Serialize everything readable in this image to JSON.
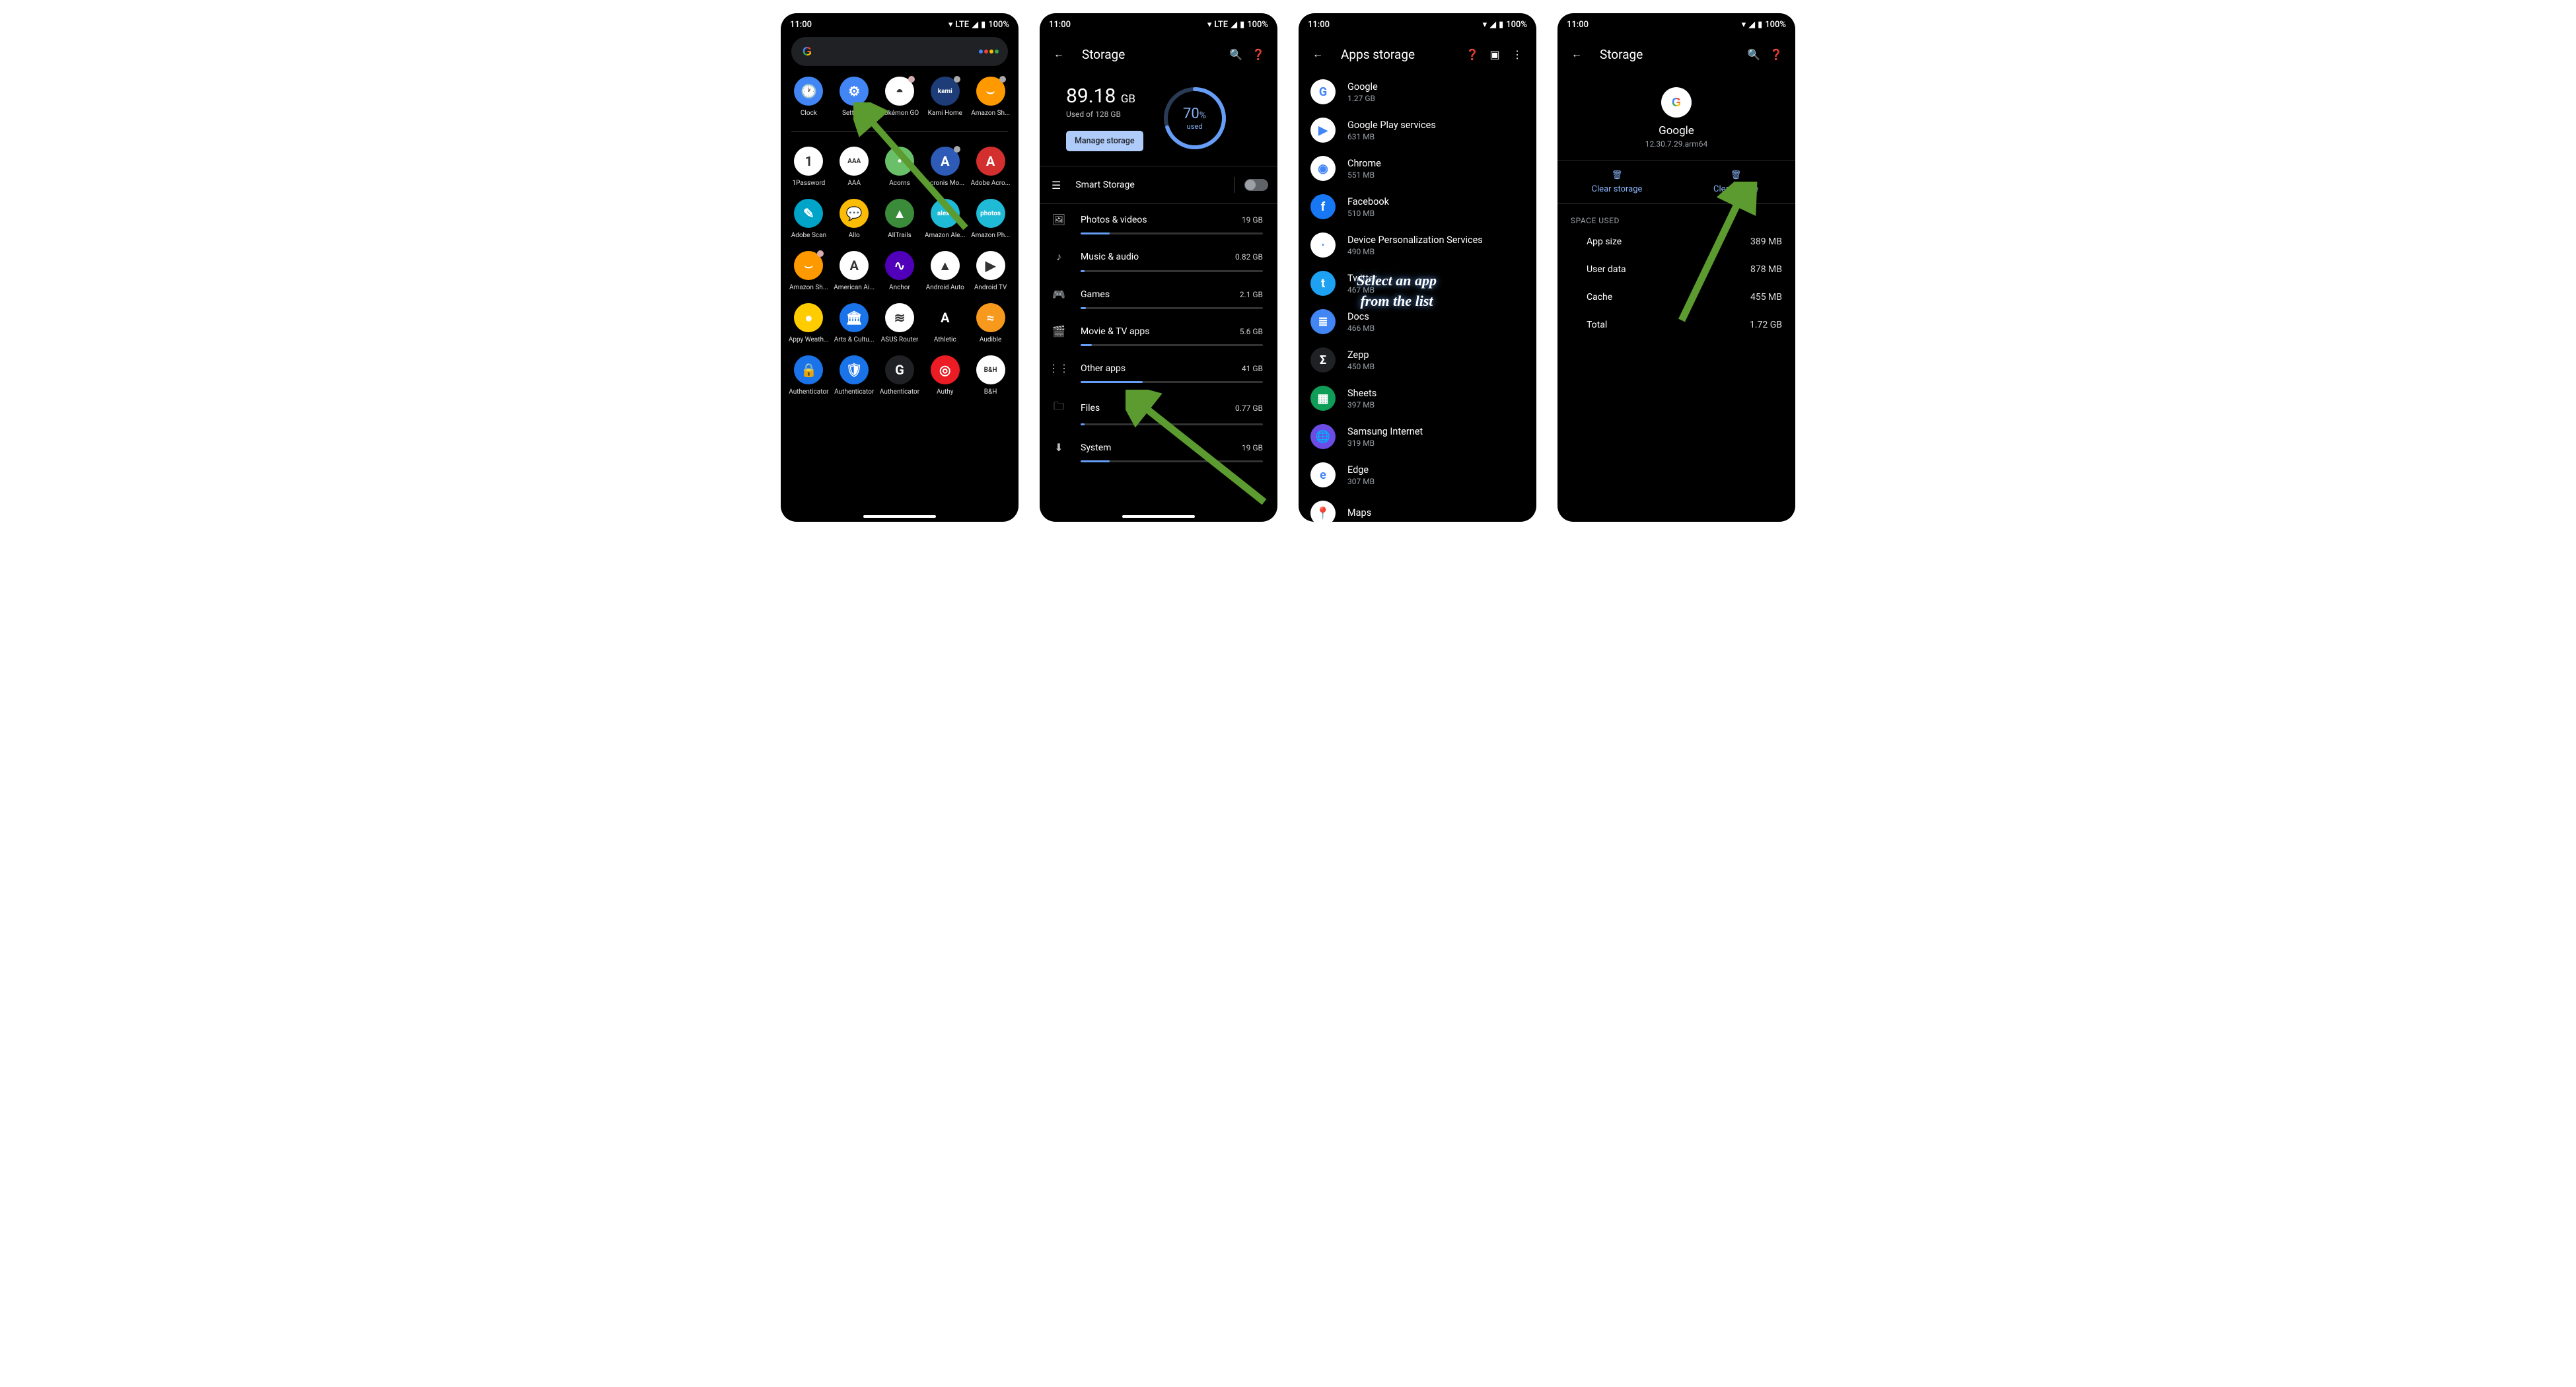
{
  "status": {
    "time": "11:00",
    "net": "LTE",
    "battery": "100%"
  },
  "screen1": {
    "apps_row1": [
      {
        "name": "Clock",
        "bg": "#4285f4",
        "char": "🕐"
      },
      {
        "name": "Settings",
        "bg": "#4285f4",
        "char": "⚙"
      },
      {
        "name": "Pokémon GO",
        "bg": "#fff",
        "char": "◓",
        "dot": "#d6aeb1"
      },
      {
        "name": "Kami Home",
        "bg": "#1d3c78",
        "char": "kami",
        "dot": "#aaa"
      },
      {
        "name": "Amazon Sh...",
        "bg": "#ff9900",
        "char": "⌣",
        "dot": "#aaa"
      }
    ],
    "apps_rest": [
      {
        "name": "1Password",
        "bg": "#fff",
        "char": "1"
      },
      {
        "name": "AAA",
        "bg": "#fff",
        "char": "AAA"
      },
      {
        "name": "Acorns",
        "bg": "#6ac069",
        "char": "•"
      },
      {
        "name": "Acronis Mo...",
        "bg": "#2d5bb7",
        "char": "A",
        "dot": "#aaa"
      },
      {
        "name": "Adobe Acro...",
        "bg": "#d32f2f",
        "char": "A"
      },
      {
        "name": "Adobe Scan",
        "bg": "#00a4c8",
        "char": "✎"
      },
      {
        "name": "Allo",
        "bg": "#fbbc05",
        "char": "💬"
      },
      {
        "name": "AllTrails",
        "bg": "#3a8b3a",
        "char": "▲"
      },
      {
        "name": "Amazon Ale...",
        "bg": "#1fbad6",
        "char": "alexa"
      },
      {
        "name": "Amazon Ph...",
        "bg": "#1fbad6",
        "char": "photos"
      },
      {
        "name": "Amazon Sh...",
        "bg": "#ff9900",
        "char": "⌣",
        "dot": "#d6aeb1"
      },
      {
        "name": "American Ai...",
        "bg": "#fff",
        "char": "A"
      },
      {
        "name": "Anchor",
        "bg": "#5000b9",
        "char": "∿"
      },
      {
        "name": "Android Auto",
        "bg": "#fff",
        "char": "▲"
      },
      {
        "name": "Android TV",
        "bg": "#fff",
        "char": "▶"
      },
      {
        "name": "Appy Weath...",
        "bg": "#ffcc00",
        "char": "●"
      },
      {
        "name": "Arts & Cultu...",
        "bg": "#1a73e8",
        "char": "🏛"
      },
      {
        "name": "ASUS Router",
        "bg": "#fff",
        "char": "≋"
      },
      {
        "name": "Athletic",
        "bg": "#000",
        "char": "A"
      },
      {
        "name": "Audible",
        "bg": "#f7991c",
        "char": "≈"
      },
      {
        "name": "Authenticator",
        "bg": "#1a73e8",
        "char": "🔒"
      },
      {
        "name": "Authenticator",
        "bg": "#1a73e8",
        "char": "🛡"
      },
      {
        "name": "Authenticator",
        "bg": "#202124",
        "char": "G"
      },
      {
        "name": "Authy",
        "bg": "#ec1c24",
        "char": "◎"
      },
      {
        "name": "B&H",
        "bg": "#fff",
        "char": "B&H"
      }
    ]
  },
  "screen2": {
    "title": "Storage",
    "used_value": "89.18",
    "used_unit": "GB",
    "total_label": "Used of 128 GB",
    "manage_label": "Manage storage",
    "pct_value": "70",
    "pct_unit": "%",
    "pct_label": "used",
    "smart_label": "Smart Storage",
    "categories": [
      {
        "icon": "🖼",
        "name": "Photos & videos",
        "value": "19 GB",
        "fill": 16
      },
      {
        "icon": "♪",
        "name": "Music & audio",
        "value": "0.82 GB",
        "fill": 2
      },
      {
        "icon": "🎮",
        "name": "Games",
        "value": "2.1 GB",
        "fill": 3
      },
      {
        "icon": "🎬",
        "name": "Movie & TV apps",
        "value": "5.6 GB",
        "fill": 6
      },
      {
        "icon": "⋮⋮",
        "name": "Other apps",
        "value": "41 GB",
        "fill": 34
      },
      {
        "icon": "🗀",
        "name": "Files",
        "value": "0.77 GB",
        "fill": 2
      },
      {
        "icon": "⬇",
        "name": "System",
        "value": "19 GB",
        "fill": 16
      }
    ]
  },
  "screen3": {
    "title": "Apps storage",
    "overlay": "Select an app\nfrom the list",
    "apps": [
      {
        "name": "Google",
        "size": "1.27 GB",
        "bg": "#fff",
        "char": "G"
      },
      {
        "name": "Google Play services",
        "size": "631 MB",
        "bg": "#fff",
        "char": "▶"
      },
      {
        "name": "Chrome",
        "size": "551 MB",
        "bg": "#fff",
        "char": "◉"
      },
      {
        "name": "Facebook",
        "size": "510 MB",
        "bg": "#1877f2",
        "char": "f"
      },
      {
        "name": "Device Personalization Services",
        "size": "490 MB",
        "bg": "#fff",
        "char": "·"
      },
      {
        "name": "Twitter",
        "size": "467 MB",
        "bg": "#1da1f2",
        "char": "t"
      },
      {
        "name": "Docs",
        "size": "466 MB",
        "bg": "#4285f4",
        "char": "≣"
      },
      {
        "name": "Zepp",
        "size": "450 MB",
        "bg": "#202124",
        "char": "Σ"
      },
      {
        "name": "Sheets",
        "size": "397 MB",
        "bg": "#0f9d58",
        "char": "▦"
      },
      {
        "name": "Samsung Internet",
        "size": "319 MB",
        "bg": "#6b4de6",
        "char": "🌐"
      },
      {
        "name": "Edge",
        "size": "307 MB",
        "bg": "#fff",
        "char": "e"
      },
      {
        "name": "Maps",
        "size": "",
        "bg": "#fff",
        "char": "📍"
      }
    ]
  },
  "screen4": {
    "title": "Storage",
    "app_name": "Google",
    "app_version": "12.30.7.29.arm64",
    "clear_storage": "Clear storage",
    "clear_cache": "Clear cache",
    "section": "Space used",
    "rows": [
      {
        "k": "App size",
        "v": "389 MB"
      },
      {
        "k": "User data",
        "v": "878 MB"
      },
      {
        "k": "Cache",
        "v": "455 MB"
      },
      {
        "k": "Total",
        "v": "1.72 GB"
      }
    ]
  }
}
